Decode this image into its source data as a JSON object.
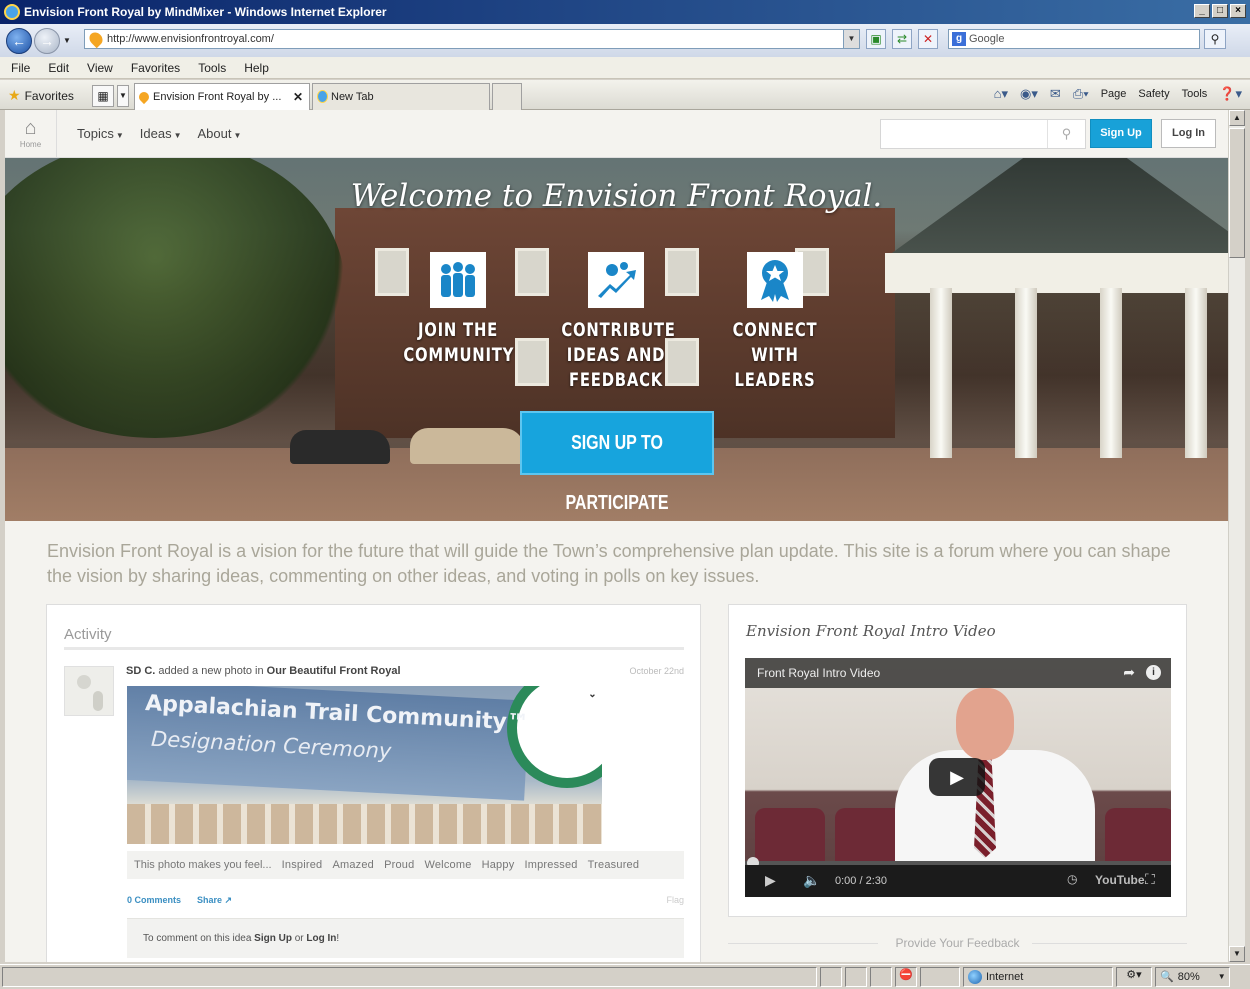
{
  "window": {
    "title": "Envision Front Royal by MindMixer - Windows Internet Explorer",
    "controls": [
      "_",
      "□",
      "×"
    ]
  },
  "address_bar": {
    "url": "http://www.envisionfrontroyal.com/",
    "search_placeholder": "Google"
  },
  "menu": [
    "File",
    "Edit",
    "View",
    "Favorites",
    "Tools",
    "Help"
  ],
  "favorites_label": "Favorites",
  "tabs": [
    {
      "label": "Envision Front Royal by ...",
      "active": true
    },
    {
      "label": "New Tab",
      "active": false
    }
  ],
  "command_bar": [
    "Page",
    "Safety",
    "Tools"
  ],
  "site": {
    "home_label": "Home",
    "nav": [
      "Topics",
      "Ideas",
      "About"
    ],
    "signup": "Sign Up",
    "login": "Log In"
  },
  "hero": {
    "title": "Welcome to Envision Front Royal.",
    "pillars": [
      {
        "line1": "JOIN THE",
        "line2": "COMMUNITY",
        "line3": "",
        "icon": "people-icon"
      },
      {
        "line1": "CONTRIBUTE",
        "line2": "IDEAS AND",
        "line3": "FEEDBACK",
        "icon": "gears-arrow-icon"
      },
      {
        "line1": "CONNECT WITH",
        "line2": "LEADERS",
        "line3": "",
        "icon": "award-ribbon-icon"
      }
    ],
    "cta": "SIGN UP TO PARTICIPATE"
  },
  "intro": "Envision Front Royal is a vision for the future that will guide the Town’s comprehensive plan update. This site is a forum where you can shape the vision by sharing ideas, commenting on other ideas, and voting in polls on key issues.",
  "activity": {
    "title": "Activity",
    "item": {
      "user": "SD C.",
      "action": "added a new photo in",
      "topic": "Our Beautiful Front Royal",
      "date": "October 22nd",
      "photo_text_1": "Appalachian Trail Community™",
      "photo_text_2": "Designation Ceremony",
      "feel_prompt": "This photo makes you feel...",
      "feelings": [
        "Inspired",
        "Amazed",
        "Proud",
        "Welcome",
        "Happy",
        "Impressed",
        "Treasured"
      ],
      "comments": "0 Comments",
      "share": "Share",
      "flag": "Flag",
      "comment_prompt_pre": "To comment on this idea",
      "comment_signup": "Sign Up",
      "comment_or": "or",
      "comment_login": "Log In",
      "comment_end": "!"
    }
  },
  "video": {
    "panel_title": "Envision Front Royal Intro Video",
    "player_title": "Front Royal Intro Video",
    "time": "0:00 / 2:30",
    "brand": "YouTube"
  },
  "feedback_heading": "Provide Your Feedback",
  "status": {
    "zone": "Internet",
    "zoom": "80%"
  },
  "colors": {
    "accent": "#18a1d8",
    "intro_text": "#a9a699"
  }
}
